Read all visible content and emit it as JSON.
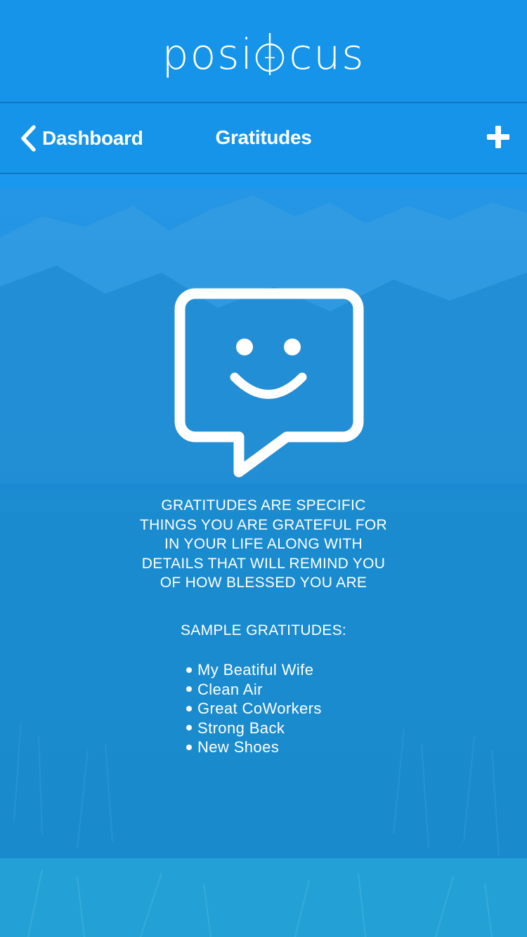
{
  "app": {
    "logo_text_left": "pos",
    "logo_text_i": "i",
    "logo_text_right": "cus",
    "brand_color": "#1594ea"
  },
  "nav": {
    "back_label": "Dashboard",
    "back_icon": "chevron-left-icon",
    "title": "Gratitudes",
    "add_icon": "plus-icon"
  },
  "main": {
    "illustration_icon": "smiley-chat-bubble-icon",
    "description": "GRATITUDES ARE SPECIFIC\nTHINGS YOU ARE GRATEFUL FOR\nIN YOUR LIFE ALONG WITH\nDETAILS THAT WILL REMIND YOU\nOF HOW BLESSED YOU ARE",
    "sample_heading": "SAMPLE GRATITUDES:",
    "samples": [
      "My Beatiful Wife",
      "Clean Air",
      "Great CoWorkers",
      "Strong Back",
      "New Shoes"
    ]
  }
}
